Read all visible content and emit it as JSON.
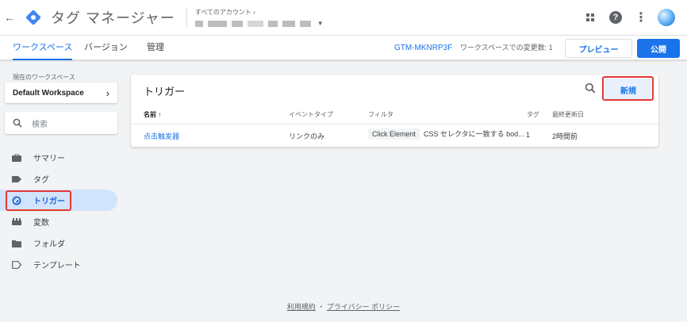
{
  "header": {
    "app_title": "タグ マネージャー",
    "account_label": "すべてのアカウント ›"
  },
  "tabs": {
    "workspace": "ワークスペース",
    "versions": "バージョン",
    "admin": "管理"
  },
  "toolbar": {
    "container_id": "GTM-MKNRP3F",
    "changes_text": "ワークスペースでの変更数: 1",
    "preview_label": "プレビュー",
    "publish_label": "公開"
  },
  "sidebar": {
    "workspace_label": "現在のワークスペース",
    "workspace_name": "Default Workspace",
    "search_placeholder": "検索",
    "items": [
      {
        "label": "サマリー",
        "icon": "briefcase-icon"
      },
      {
        "label": "タグ",
        "icon": "tag-icon"
      },
      {
        "label": "トリガー",
        "icon": "trigger-icon"
      },
      {
        "label": "変数",
        "icon": "variables-icon"
      },
      {
        "label": "フォルダ",
        "icon": "folder-icon"
      },
      {
        "label": "テンプレート",
        "icon": "template-icon"
      }
    ]
  },
  "main": {
    "title": "トリガー",
    "new_label": "新規",
    "columns": {
      "name": "名前 ↑",
      "event_type": "イベントタイプ",
      "filter": "フィルタ",
      "tags": "タグ",
      "last_edited": "最終更新日"
    },
    "rows": [
      {
        "name": "点击触发器",
        "event_type": "リンクのみ",
        "filter_chip": "Click Element",
        "filter_text": "CSS セレクタに一致する bod...",
        "tags": "1",
        "last_edited": "2時間前"
      }
    ]
  },
  "footer": {
    "terms": "利用規約",
    "dot": "・",
    "privacy": "プライバシー ポリシー"
  },
  "colors": {
    "accent": "#1a73e8",
    "highlight": "#e53935",
    "active_nav_bg": "#d2e3fc"
  }
}
